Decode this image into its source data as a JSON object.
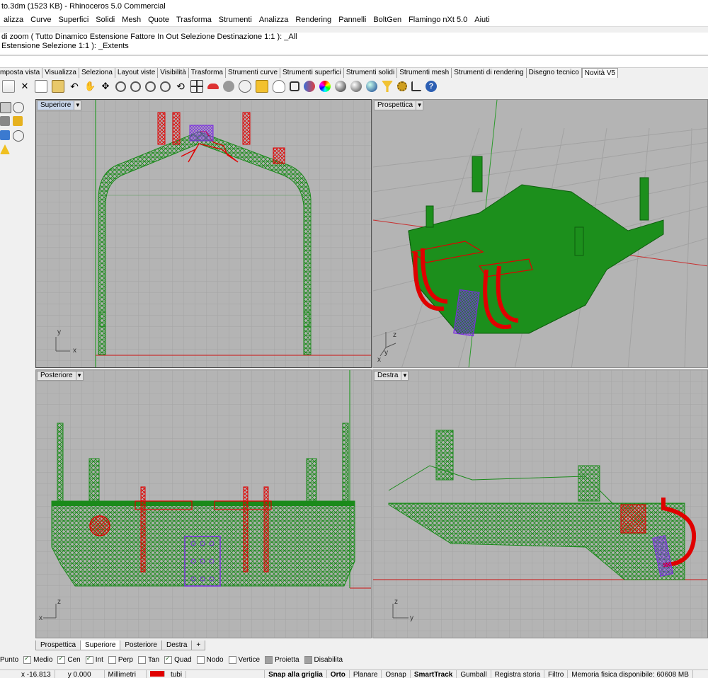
{
  "window": {
    "title": "to.3dm (1523 KB) - Rhinoceros 5.0 Commercial"
  },
  "menu": [
    "alizza",
    "Curve",
    "Superfici",
    "Solidi",
    "Mesh",
    "Quote",
    "Trasforma",
    "Strumenti",
    "Analizza",
    "Rendering",
    "Pannelli",
    "BoltGen",
    "Flamingo nXt 5.0",
    "Aiuti"
  ],
  "command_history": [
    "di zoom ( Tutto  Dinamico  Estensione  Fattore  In  Out  Selezione  Destinazione  1:1 ): _All",
    " Estensione  Selezione  1:1 ): _Extents"
  ],
  "toolbar_tabs": [
    "mposta vista",
    "Visualizza",
    "Seleziona",
    "Layout viste",
    "Visibilità",
    "Trasforma",
    "Strumenti curve",
    "Strumenti superfici",
    "Strumenti solidi",
    "Strumenti mesh",
    "Strumenti di rendering",
    "Disegno tecnico",
    "Novità V5"
  ],
  "viewports": {
    "top": {
      "label": "Superiore",
      "axis1": "y",
      "axis2": "x"
    },
    "perspective": {
      "label": "Prospettica",
      "axis1": "z",
      "axis2": "y",
      "axis3": "x"
    },
    "back": {
      "label": "Posteriore",
      "axis1": "z",
      "axis2": "x"
    },
    "right": {
      "label": "Destra",
      "axis1": "z",
      "axis2": "y"
    }
  },
  "viewport_tabs": [
    "Prospettica",
    "Superiore",
    "Posteriore",
    "Destra"
  ],
  "viewport_tab_add": "+",
  "osnap": [
    {
      "label": "Punto",
      "checked": false
    },
    {
      "label": "Medio",
      "checked": true
    },
    {
      "label": "Cen",
      "checked": true
    },
    {
      "label": "Int",
      "checked": true
    },
    {
      "label": "Perp",
      "checked": false
    },
    {
      "label": "Tan",
      "checked": false
    },
    {
      "label": "Quad",
      "checked": true
    },
    {
      "label": "Nodo",
      "checked": false
    },
    {
      "label": "Vertice",
      "checked": false
    },
    {
      "label": "Proietta",
      "checked": false
    },
    {
      "label": "Disabilita",
      "checked": false
    }
  ],
  "status": {
    "x": "x -16.813",
    "y": "y 0.000",
    "units": "Millimetri",
    "layer": "tubi",
    "snap": "Snap alla griglia",
    "orto": "Orto",
    "planare": "Planare",
    "osnap": "Osnap",
    "smarttrack": "SmartTrack",
    "gumball": "Gumball",
    "registra": "Registra storia",
    "filtro": "Filtro",
    "memoria": "Memoria fisica disponibile: 60608 MB"
  },
  "colors": {
    "viewport_bg": "#b4b4b4",
    "grid": "#a2a2a2",
    "mesh_green": "#1a8a1a",
    "parts_red": "#e00000",
    "part_purple": "#7b2ee0",
    "axis_red": "#c83030",
    "axis_green": "#2c9a2c"
  }
}
